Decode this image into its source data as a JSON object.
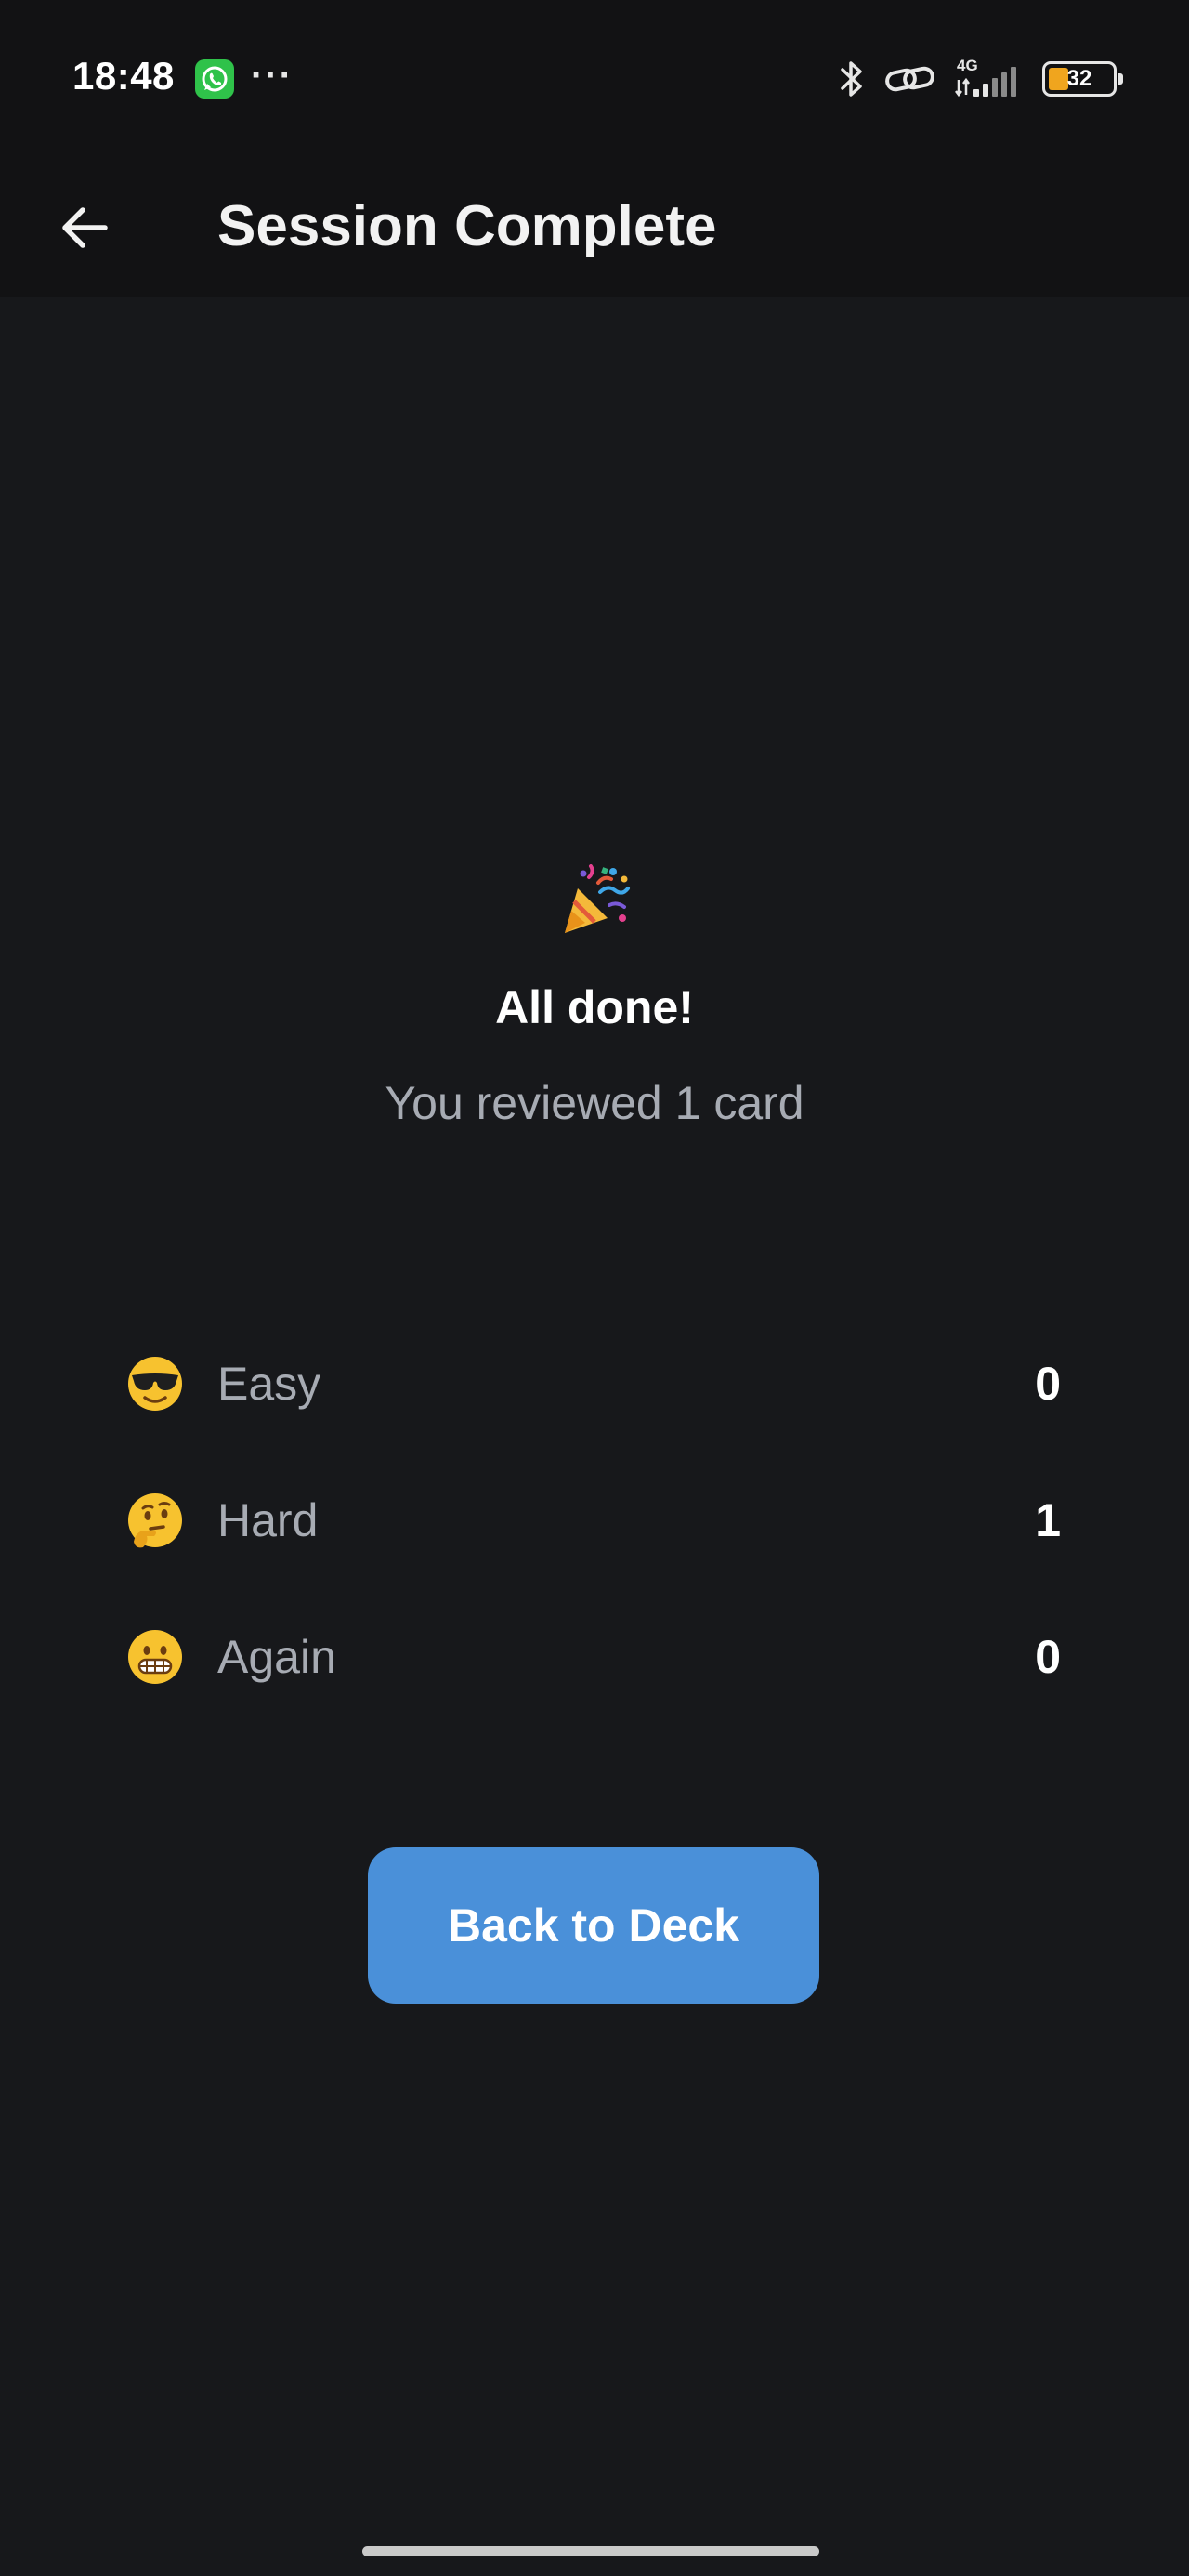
{
  "status_bar": {
    "time": "18:48",
    "network": "4G",
    "battery_level": "32",
    "battery_fill_percent": 32
  },
  "app_bar": {
    "title": "Session Complete",
    "back_icon": "arrow-left-icon"
  },
  "summary": {
    "icon": "party-popper-icon",
    "heading": "All done!",
    "subtitle": "You reviewed 1 card"
  },
  "stats": [
    {
      "icon": "sunglasses-face-icon",
      "label": "Easy",
      "count": "0"
    },
    {
      "icon": "thinking-face-icon",
      "label": "Hard",
      "count": "1"
    },
    {
      "icon": "grimacing-face-icon",
      "label": "Again",
      "count": "0"
    }
  ],
  "actions": {
    "back_to_deck": "Back to Deck"
  },
  "colors": {
    "background": "#17181b",
    "header": "#121214",
    "accent": "#4a90d9",
    "muted_text": "#a7abb3"
  }
}
